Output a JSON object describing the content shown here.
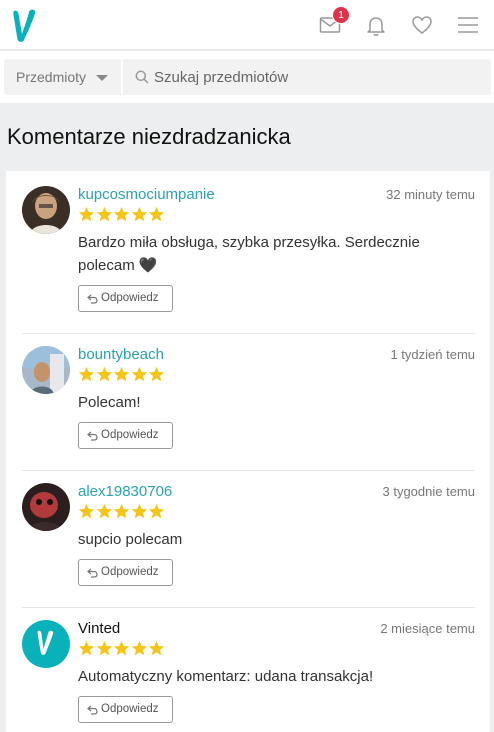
{
  "header": {
    "logo_icon": "vinted-logo",
    "inbox_badge": "1",
    "brand_color": "#09b1ba",
    "badge_color": "#e0334b"
  },
  "search": {
    "category_label": "Przedmioty",
    "placeholder": "Szukaj przedmiotów"
  },
  "page": {
    "title": "Komentarze niezdradzanicka"
  },
  "reviews": [
    {
      "user": "kupcosmociumpanie",
      "time": "32 minuty temu",
      "stars": 5,
      "text": "Bardzo miła obsługa, szybka przesyłka. Serdecznie polecam 🖤",
      "reply_label": "Odpowiedz"
    },
    {
      "user": "bountybeach",
      "time": "1 tydzień temu",
      "stars": 5,
      "text": "Polecam!",
      "reply_label": "Odpowiedz"
    },
    {
      "user": "alex19830706",
      "time": "3 tygodnie temu",
      "stars": 5,
      "text": "supcio polecam",
      "reply_label": "Odpowiedz"
    },
    {
      "user": "Vinted",
      "time": "2 miesiące temu",
      "stars": 5,
      "text": "Automatyczny komentarz: udana transakcja!",
      "reply_label": "Odpowiedz"
    }
  ],
  "star_color": "#f5c518"
}
